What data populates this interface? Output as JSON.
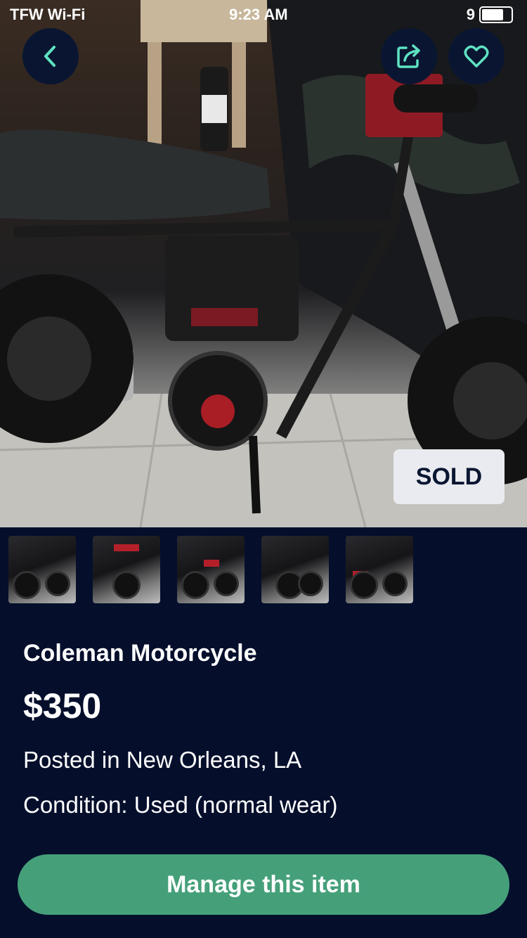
{
  "status_bar": {
    "carrier": "TFW Wi-Fi",
    "time": "9:23 AM",
    "battery": "9"
  },
  "listing": {
    "sold_badge": "SOLD",
    "title": "Coleman Motorcycle",
    "price": "$350",
    "posted": "Posted in New Orleans, LA",
    "condition": "Condition: Used (normal wear)"
  },
  "thumbnails": [
    "photo-1",
    "photo-2",
    "photo-3",
    "photo-4",
    "photo-5"
  ],
  "actions": {
    "manage_label": "Manage this item"
  },
  "icons": {
    "back": "chevron-left-icon",
    "share": "share-icon",
    "favorite": "heart-icon"
  },
  "colors": {
    "background": "#050f2c",
    "accent": "#45a07a",
    "icon": "#5ee3c2",
    "badge_bg": "#e9ebf0"
  }
}
